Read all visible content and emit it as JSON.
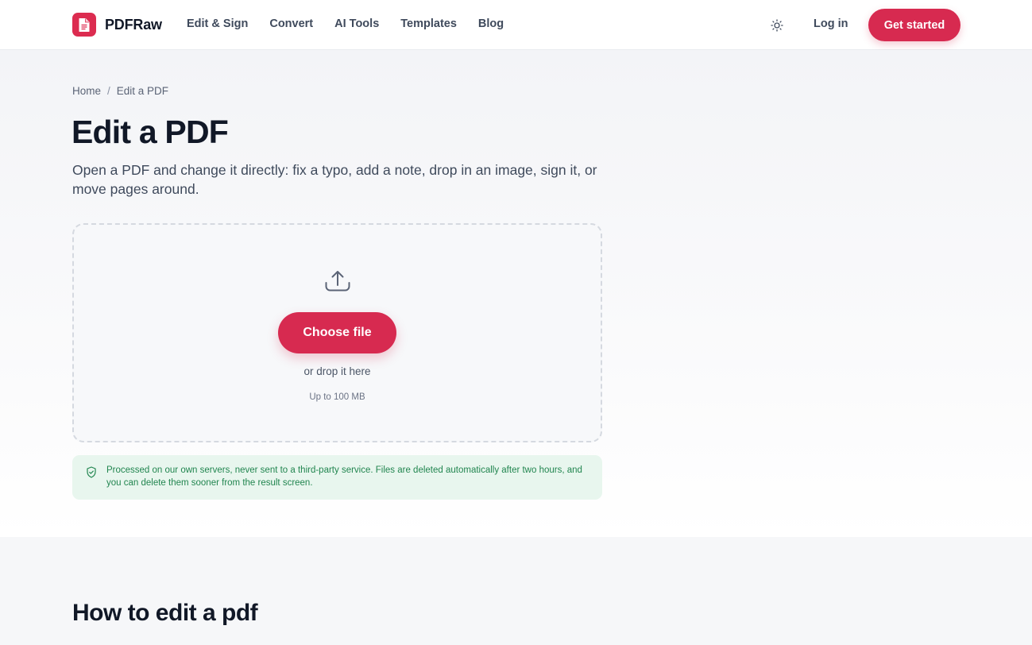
{
  "header": {
    "brand": "PDFRaw",
    "nav": [
      "Edit & Sign",
      "Convert",
      "AI Tools",
      "Templates",
      "Blog"
    ],
    "login": "Log in",
    "cta": "Get started",
    "theme_icon": "sun-icon",
    "accent": "#d72a50"
  },
  "breadcrumb": {
    "home": "Home",
    "separator": "/",
    "current": "Edit a PDF"
  },
  "hero": {
    "title": "Edit a PDF",
    "subtitle": "Open a PDF and change it directly: fix a typo, add a note, drop in an image, sign it, or move pages around."
  },
  "upload": {
    "icon": "upload-icon",
    "button": "Choose file",
    "drop_text": "or drop it here",
    "limit": "Up to 100 MB"
  },
  "notice": {
    "icon": "shield-check-icon",
    "text": "Processed on our own servers, never sent to a third-party service. Files are deleted automatically after two hours, and you can delete them sooner from the result screen.",
    "color": "#21854f"
  },
  "howto": {
    "title": "How to edit a pdf"
  }
}
